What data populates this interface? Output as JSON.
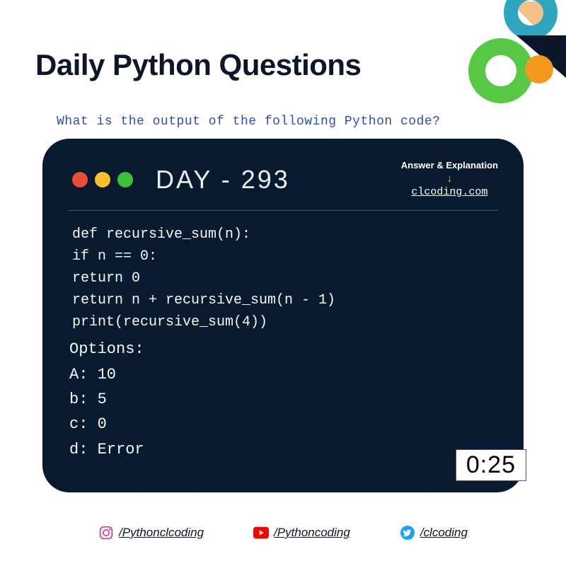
{
  "title": "Daily Python Questions",
  "question": "What is the output of the following Python code?",
  "day_label": "DAY - 293",
  "answer_hint_label": "Answer & Explanation",
  "answer_link": "clcoding.com",
  "code_lines": [
    "def recursive_sum(n):",
    "if n == 0:",
    "return 0",
    "return n + recursive_sum(n - 1)",
    "print(recursive_sum(4))"
  ],
  "options_heading": "Options:",
  "options": [
    {
      "key": "A",
      "value": "10"
    },
    {
      "key": "b",
      "value": "5"
    },
    {
      "key": "c",
      "value": "0"
    },
    {
      "key": "d",
      "value": "Error"
    }
  ],
  "timer": "0:25",
  "socials": {
    "instagram": "/Pythonclcoding",
    "youtube": "/Pythoncoding",
    "twitter": "/clcoding"
  },
  "colors": {
    "terminal_bg": "#081b2e",
    "green_ring": "#57c843",
    "teal_ring": "#2fa6bf",
    "orange_dot": "#f39a1e",
    "tri_peach": "#f6c089",
    "tri_dark": "#0b1628"
  }
}
